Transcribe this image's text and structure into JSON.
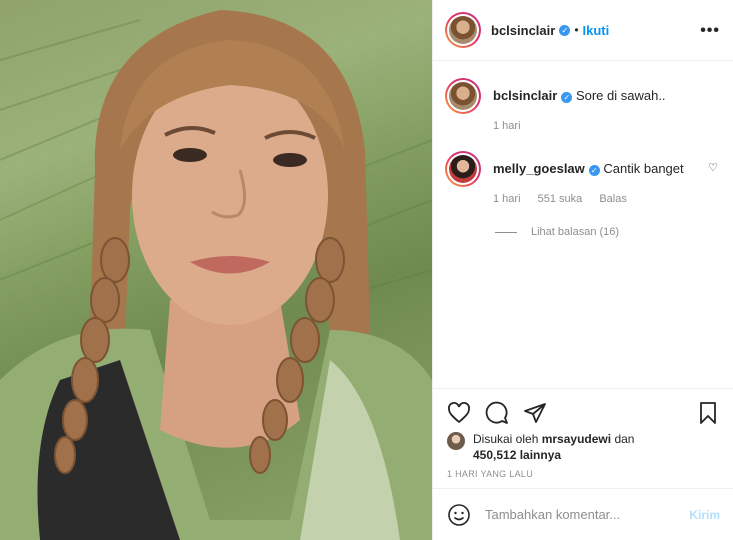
{
  "post": {
    "username": "bclsinclair",
    "follow_label": "Ikuti",
    "separator": "•",
    "more_icon": "more-dots-icon"
  },
  "caption": {
    "username": "bclsinclair",
    "text": "Sore di sawah..",
    "time": "1 hari"
  },
  "comments": [
    {
      "username": "melly_goeslaw",
      "text": "Cantik banget",
      "time": "1 hari",
      "likes": "551 suka",
      "reply_label": "Balas",
      "view_replies": "Lihat balasan (16)"
    }
  ],
  "likes": {
    "prefix": "Disukai oleh",
    "user": "mrsayudewi",
    "connector": "dan",
    "count": "450,512 lainnya"
  },
  "timestamp": "1 HARI YANG LALU",
  "comment_box": {
    "placeholder": "Tambahkan komentar...",
    "send_label": "Kirim"
  },
  "colors": {
    "accent": "#0095f6",
    "send_disabled": "#b2dffc",
    "verified": "#3897f0"
  }
}
